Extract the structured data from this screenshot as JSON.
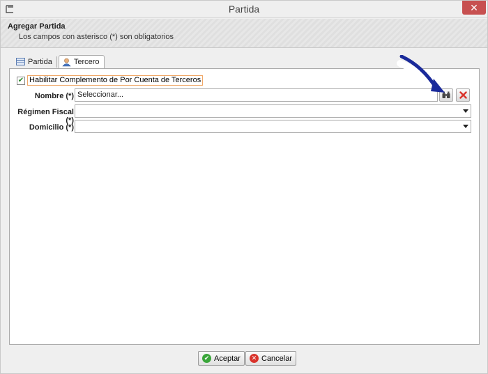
{
  "window": {
    "title": "Partida",
    "close_glyph": "✕"
  },
  "header": {
    "title": "Agregar Partida",
    "subtitle": "Los campos con asterisco (*) son obligatorios"
  },
  "tabs": [
    {
      "label": "Partida",
      "icon": "table-icon",
      "active": false
    },
    {
      "label": "Tercero",
      "icon": "user-icon",
      "active": true
    }
  ],
  "form": {
    "checkbox_label": "Habilitar Complemento de Por Cuenta de Terceros",
    "checkbox_checked": true,
    "checkbox_mark": "✔",
    "nombre_label": "Nombre (*)",
    "nombre_value": "Seleccionar...",
    "regimen_label": "Régimen Fiscal (*)",
    "regimen_value": "",
    "domicilio_label": "Domicilio (*)",
    "domicilio_value": ""
  },
  "footer": {
    "accept_label": "Aceptar",
    "cancel_label": "Cancelar",
    "accept_glyph": "✔",
    "cancel_glyph": "✕"
  },
  "colors": {
    "close_button": "#c75050",
    "accept_icon": "#3aa63a",
    "cancel_icon": "#d9332b",
    "annotation_arrow": "#1a2a9a",
    "checkbox_focus": "#f0a868"
  }
}
